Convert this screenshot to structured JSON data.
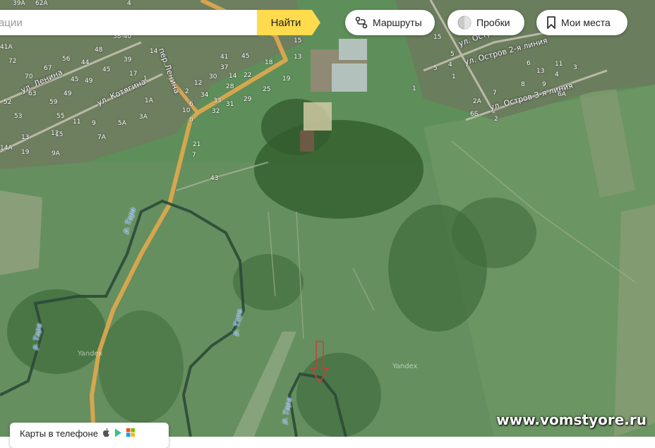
{
  "search": {
    "placeholder": "ации",
    "button_label": "Найти"
  },
  "toolbar": {
    "routes_label": "Маршруты",
    "traffic_label": "Пробки",
    "places_label": "Мои места"
  },
  "streets": {
    "lenina_lane": "пер.Ленина",
    "lenina": "ул. Ленина",
    "kotyagina": "ул. Котягина",
    "ostrov_top": "ул. Остров",
    "ostrov_2": "ул. Остров 2-я линия",
    "ostrov_3": "ул. Остров 3-я линия"
  },
  "river_labels": [
    "р. Тара",
    "р. Тара",
    "р. Тара",
    "р. Тара"
  ],
  "house_numbers": [
    "39А",
    "62А",
    "72",
    "41А",
    "56",
    "70",
    "67",
    "4",
    "48",
    "39",
    "38-40",
    "14",
    "44",
    "45",
    "49",
    "17",
    "1",
    "45",
    "41",
    "37",
    "30",
    "14",
    "12",
    "28",
    "22",
    "25",
    "18",
    "19",
    "13",
    "15",
    "1А",
    "2",
    "6",
    "8",
    "5А",
    "3А",
    "10",
    "32",
    "21",
    "34",
    "31",
    "29",
    "14А",
    "33",
    "11",
    "9",
    "7",
    "12",
    "13",
    "15",
    "7А",
    "19",
    "9А",
    "63",
    "59",
    "52",
    "55",
    "53",
    "49",
    "43",
    "45",
    "6Б",
    "5",
    "8",
    "9",
    "6А",
    "4",
    "1",
    "2А",
    "7",
    "6",
    "15",
    "13",
    "11",
    "3",
    "2",
    "1",
    "5",
    "4"
  ],
  "map": {
    "watermark_1": "Yandex",
    "watermark_2": "Yandex",
    "river_color": "#4a8fe0",
    "road_color": "#e2a84e"
  },
  "promo": {
    "label": "Карты в телефоне"
  },
  "site_watermark": "www.vomstyore.ru"
}
